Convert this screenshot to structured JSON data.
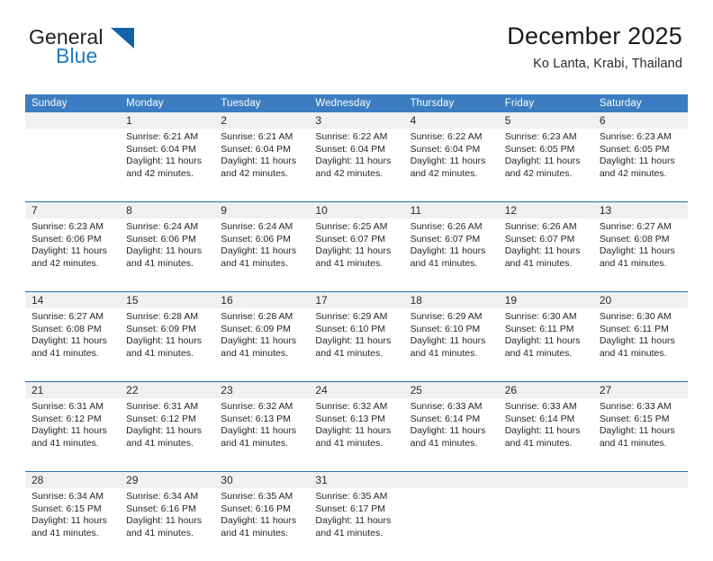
{
  "brand": {
    "word_one": "General",
    "word_two": "Blue",
    "logo_icon": "triangle-logo-icon",
    "accent_color": "#1163a8",
    "blue_text_color": "#1d7cc4"
  },
  "header": {
    "title": "December 2025",
    "subtitle": "Ko Lanta, Krabi, Thailand"
  },
  "theme": {
    "header_row_bg": "#3b7dc0",
    "daynum_band_bg": "#f0f0f0",
    "week_divider": "#2e6da8",
    "text_color": "#262626"
  },
  "calendar": {
    "weekdays": [
      "Sunday",
      "Monday",
      "Tuesday",
      "Wednesday",
      "Thursday",
      "Friday",
      "Saturday"
    ],
    "weeks": [
      [
        {
          "day": "",
          "info": ""
        },
        {
          "day": "1",
          "info": "Sunrise: 6:21 AM\nSunset: 6:04 PM\nDaylight: 11 hours\nand 42 minutes."
        },
        {
          "day": "2",
          "info": "Sunrise: 6:21 AM\nSunset: 6:04 PM\nDaylight: 11 hours\nand 42 minutes."
        },
        {
          "day": "3",
          "info": "Sunrise: 6:22 AM\nSunset: 6:04 PM\nDaylight: 11 hours\nand 42 minutes."
        },
        {
          "day": "4",
          "info": "Sunrise: 6:22 AM\nSunset: 6:04 PM\nDaylight: 11 hours\nand 42 minutes."
        },
        {
          "day": "5",
          "info": "Sunrise: 6:23 AM\nSunset: 6:05 PM\nDaylight: 11 hours\nand 42 minutes."
        },
        {
          "day": "6",
          "info": "Sunrise: 6:23 AM\nSunset: 6:05 PM\nDaylight: 11 hours\nand 42 minutes."
        }
      ],
      [
        {
          "day": "7",
          "info": "Sunrise: 6:23 AM\nSunset: 6:06 PM\nDaylight: 11 hours\nand 42 minutes."
        },
        {
          "day": "8",
          "info": "Sunrise: 6:24 AM\nSunset: 6:06 PM\nDaylight: 11 hours\nand 41 minutes."
        },
        {
          "day": "9",
          "info": "Sunrise: 6:24 AM\nSunset: 6:06 PM\nDaylight: 11 hours\nand 41 minutes."
        },
        {
          "day": "10",
          "info": "Sunrise: 6:25 AM\nSunset: 6:07 PM\nDaylight: 11 hours\nand 41 minutes."
        },
        {
          "day": "11",
          "info": "Sunrise: 6:26 AM\nSunset: 6:07 PM\nDaylight: 11 hours\nand 41 minutes."
        },
        {
          "day": "12",
          "info": "Sunrise: 6:26 AM\nSunset: 6:07 PM\nDaylight: 11 hours\nand 41 minutes."
        },
        {
          "day": "13",
          "info": "Sunrise: 6:27 AM\nSunset: 6:08 PM\nDaylight: 11 hours\nand 41 minutes."
        }
      ],
      [
        {
          "day": "14",
          "info": "Sunrise: 6:27 AM\nSunset: 6:08 PM\nDaylight: 11 hours\nand 41 minutes."
        },
        {
          "day": "15",
          "info": "Sunrise: 6:28 AM\nSunset: 6:09 PM\nDaylight: 11 hours\nand 41 minutes."
        },
        {
          "day": "16",
          "info": "Sunrise: 6:28 AM\nSunset: 6:09 PM\nDaylight: 11 hours\nand 41 minutes."
        },
        {
          "day": "17",
          "info": "Sunrise: 6:29 AM\nSunset: 6:10 PM\nDaylight: 11 hours\nand 41 minutes."
        },
        {
          "day": "18",
          "info": "Sunrise: 6:29 AM\nSunset: 6:10 PM\nDaylight: 11 hours\nand 41 minutes."
        },
        {
          "day": "19",
          "info": "Sunrise: 6:30 AM\nSunset: 6:11 PM\nDaylight: 11 hours\nand 41 minutes."
        },
        {
          "day": "20",
          "info": "Sunrise: 6:30 AM\nSunset: 6:11 PM\nDaylight: 11 hours\nand 41 minutes."
        }
      ],
      [
        {
          "day": "21",
          "info": "Sunrise: 6:31 AM\nSunset: 6:12 PM\nDaylight: 11 hours\nand 41 minutes."
        },
        {
          "day": "22",
          "info": "Sunrise: 6:31 AM\nSunset: 6:12 PM\nDaylight: 11 hours\nand 41 minutes."
        },
        {
          "day": "23",
          "info": "Sunrise: 6:32 AM\nSunset: 6:13 PM\nDaylight: 11 hours\nand 41 minutes."
        },
        {
          "day": "24",
          "info": "Sunrise: 6:32 AM\nSunset: 6:13 PM\nDaylight: 11 hours\nand 41 minutes."
        },
        {
          "day": "25",
          "info": "Sunrise: 6:33 AM\nSunset: 6:14 PM\nDaylight: 11 hours\nand 41 minutes."
        },
        {
          "day": "26",
          "info": "Sunrise: 6:33 AM\nSunset: 6:14 PM\nDaylight: 11 hours\nand 41 minutes."
        },
        {
          "day": "27",
          "info": "Sunrise: 6:33 AM\nSunset: 6:15 PM\nDaylight: 11 hours\nand 41 minutes."
        }
      ],
      [
        {
          "day": "28",
          "info": "Sunrise: 6:34 AM\nSunset: 6:15 PM\nDaylight: 11 hours\nand 41 minutes."
        },
        {
          "day": "29",
          "info": "Sunrise: 6:34 AM\nSunset: 6:16 PM\nDaylight: 11 hours\nand 41 minutes."
        },
        {
          "day": "30",
          "info": "Sunrise: 6:35 AM\nSunset: 6:16 PM\nDaylight: 11 hours\nand 41 minutes."
        },
        {
          "day": "31",
          "info": "Sunrise: 6:35 AM\nSunset: 6:17 PM\nDaylight: 11 hours\nand 41 minutes."
        },
        {
          "day": "",
          "info": ""
        },
        {
          "day": "",
          "info": ""
        },
        {
          "day": "",
          "info": ""
        }
      ]
    ]
  }
}
